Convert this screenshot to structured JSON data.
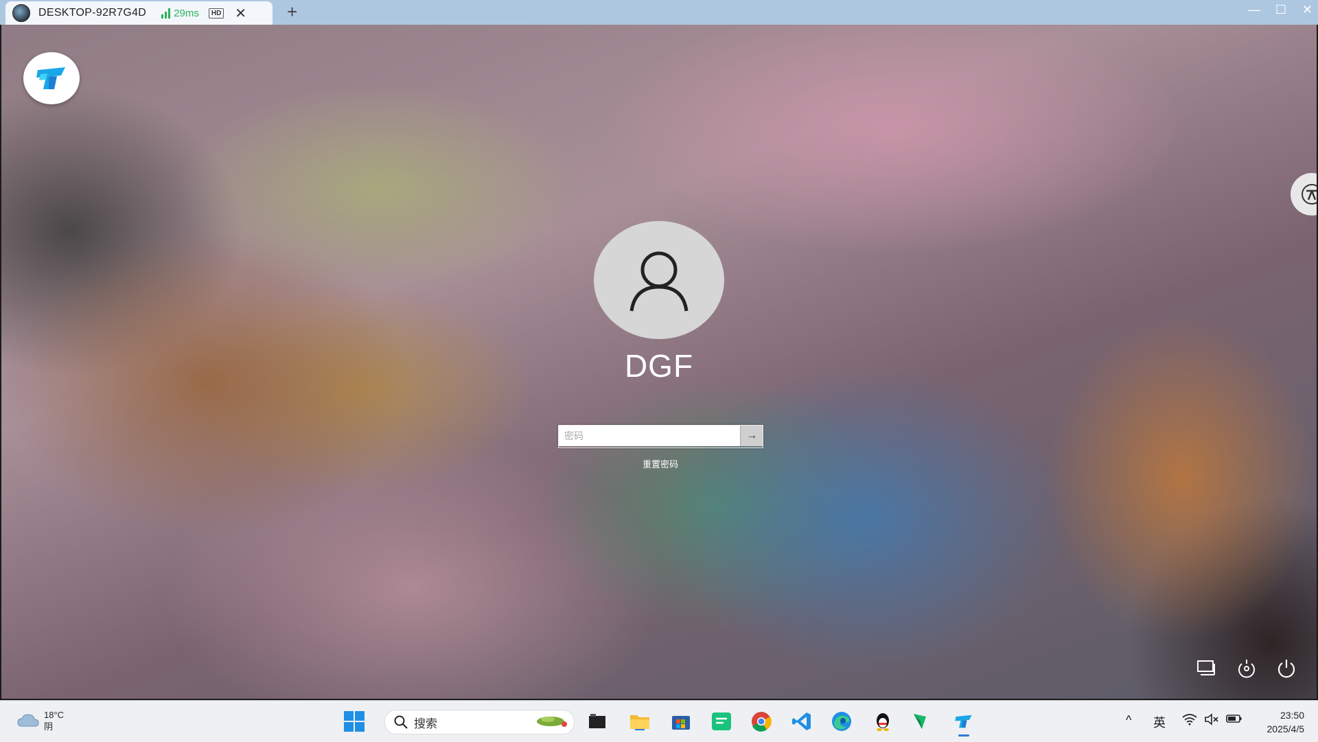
{
  "window": {
    "tab_title": "DESKTOP-92R7G4D",
    "ping": "29ms",
    "quality_badge": "HD",
    "close_tab": "✕",
    "new_tab": "+"
  },
  "lock_screen": {
    "username": "DGF",
    "password_placeholder": "密码",
    "submit_arrow": "→",
    "reset_password_link": "重置密码"
  },
  "taskbar": {
    "weather_temp": "18°C",
    "weather_desc": "阴",
    "search_label": "搜索",
    "input_method": "英",
    "time": "23:50",
    "date": "2025/4/5"
  }
}
